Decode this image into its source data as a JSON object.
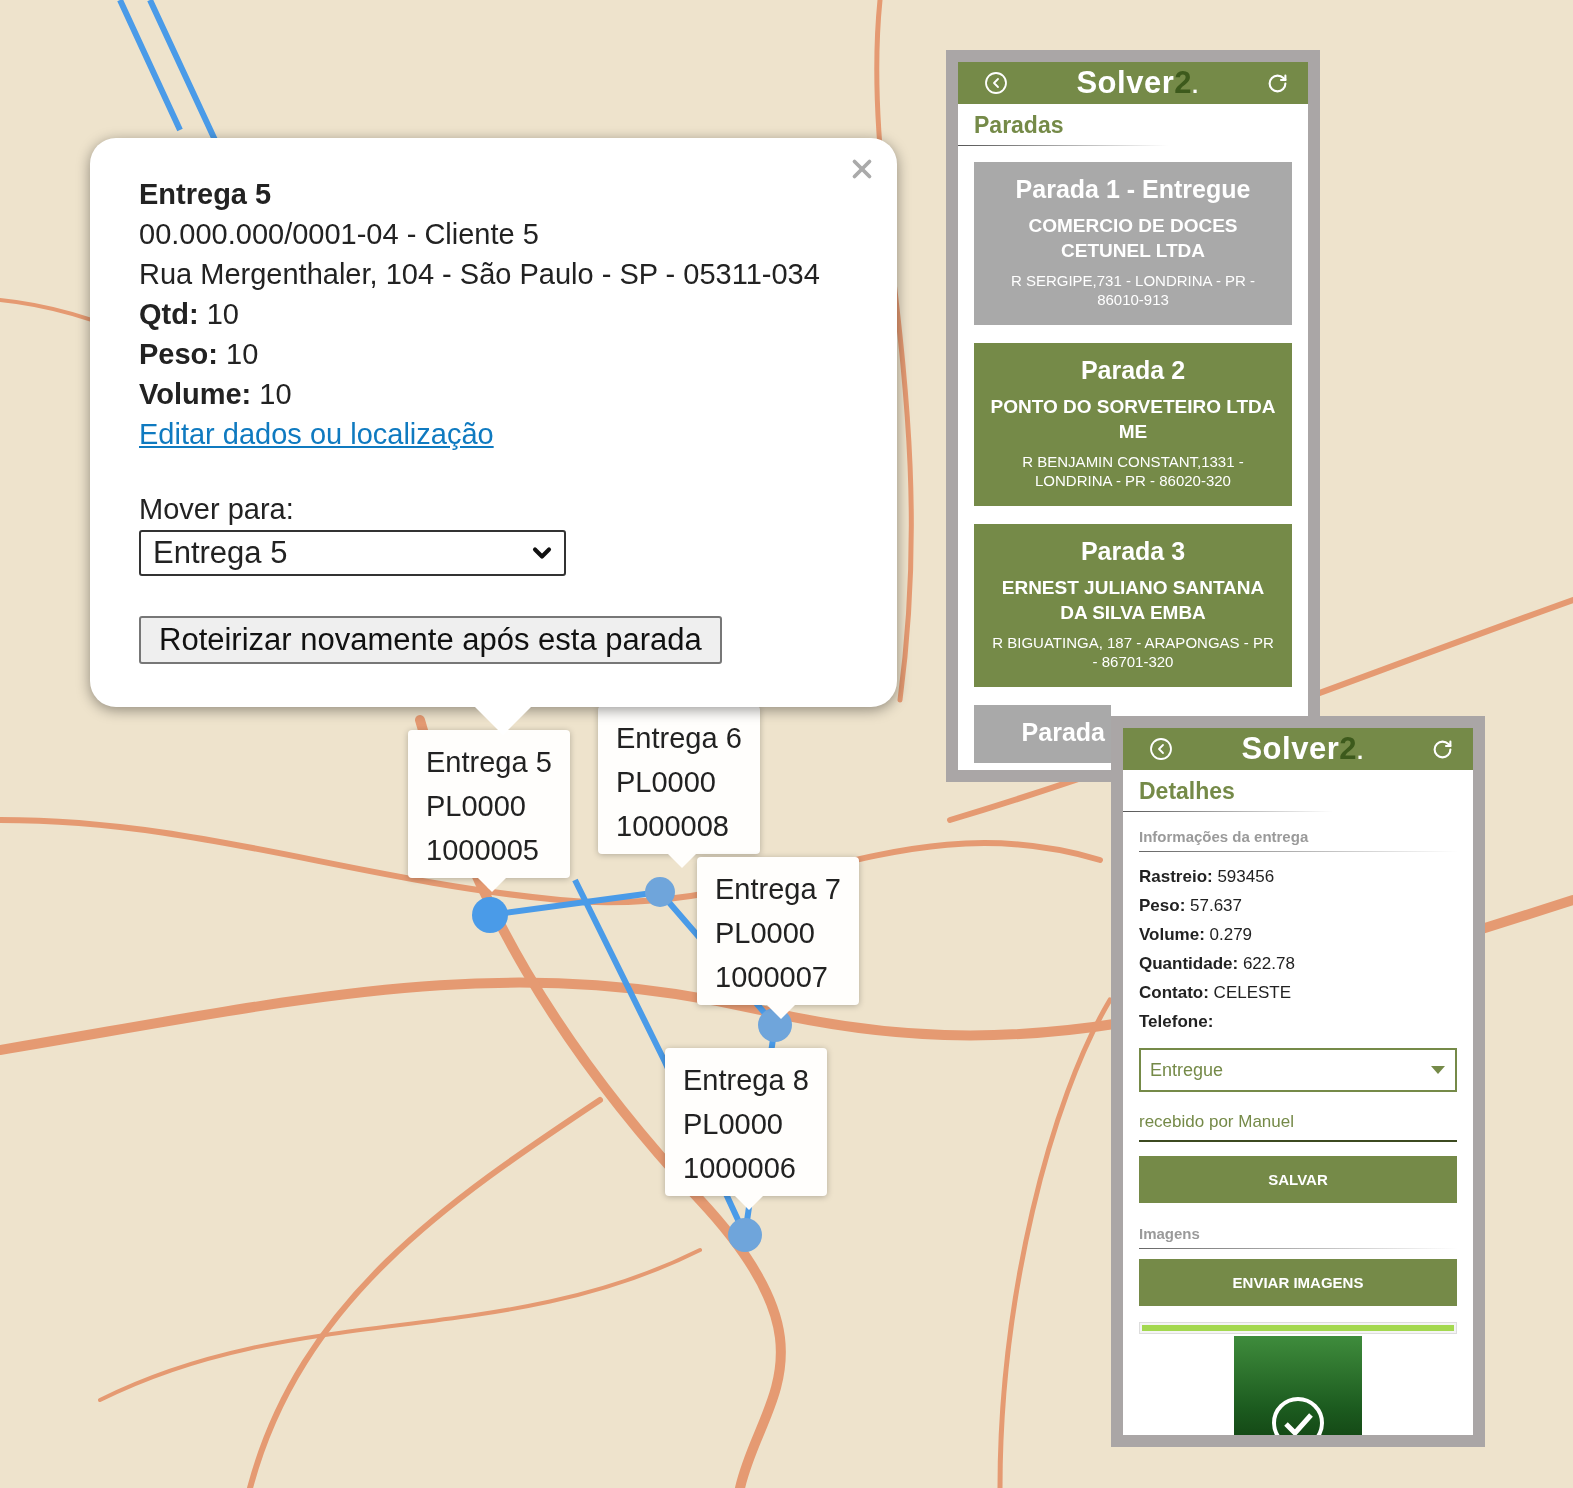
{
  "map": {
    "markers": [
      {
        "label": "Entrega 5",
        "lines": [
          "PL0000",
          "1000005"
        ]
      },
      {
        "label": "Entrega 6",
        "lines": [
          "PL0000",
          "1000008"
        ]
      },
      {
        "label": "Entrega 7",
        "lines": [
          "PL0000",
          "1000007"
        ]
      },
      {
        "label": "Entrega 8",
        "lines": [
          "PL0000",
          "1000006"
        ]
      }
    ]
  },
  "popup": {
    "title": "Entrega 5",
    "lines": [
      "00.000.000/0001-04 - Cliente 5",
      "Rua Mergenthaler, 104 - São Paulo - SP - 05311-034"
    ],
    "fields": [
      {
        "label": "Qtd:",
        "value": "10"
      },
      {
        "label": "Peso:",
        "value": "10"
      },
      {
        "label": "Volume:",
        "value": "10"
      }
    ],
    "link": "Editar dados ou localização",
    "move_label": "Mover para:",
    "move_value": "Entrega 5",
    "button": "Roteirizar novamente após esta parada"
  },
  "stops_panel": {
    "logo": {
      "main": "Solver",
      "accent": "2",
      "mark": "."
    },
    "title": "Paradas",
    "stops": [
      {
        "title": "Parada 1 - Entregue",
        "name": "COMERCIO DE DOCES CETUNEL LTDA",
        "address": "R SERGIPE,731 - LONDRINA - PR - 86010-913",
        "delivered": true
      },
      {
        "title": "Parada 2",
        "name": "PONTO DO SORVETEIRO LTDA ME",
        "address": "R BENJAMIN CONSTANT,1331 - LONDRINA - PR - 86020-320",
        "delivered": false
      },
      {
        "title": "Parada 3",
        "name": "ERNEST JULIANO SANTANA DA SILVA EMBA",
        "address": "R BIGUATINGA, 187 - ARAPONGAS - PR - 86701-320",
        "delivered": false
      },
      {
        "title": "Parada",
        "delivered": true
      }
    ]
  },
  "details_panel": {
    "logo": {
      "main": "Solver",
      "accent": "2",
      "mark": "."
    },
    "title": "Detalhes",
    "section": "Informações da entrega",
    "fields": [
      {
        "label": "Rastreio:",
        "value": "593456"
      },
      {
        "label": "Peso:",
        "value": "57.637"
      },
      {
        "label": "Volume:",
        "value": "0.279"
      },
      {
        "label": "Quantidade:",
        "value": "622.78"
      },
      {
        "label": "Contato:",
        "value": "CELESTE"
      },
      {
        "label": "Telefone:"
      }
    ],
    "status": "Entregue",
    "note": "recebido por Manuel",
    "save": "SALVAR",
    "images_section": "Imagens",
    "upload": "ENVIAR IMAGENS",
    "upload_progress": {
      "level": 1
    }
  }
}
